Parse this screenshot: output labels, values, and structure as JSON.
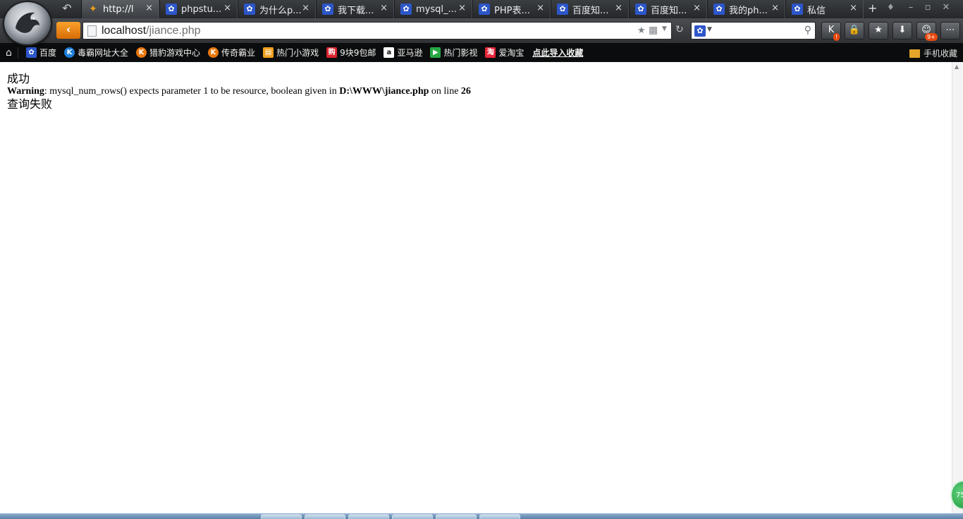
{
  "browser": {
    "tabs": [
      {
        "title": "http://l",
        "favicon": "kitty-favicon-icon",
        "active": true
      },
      {
        "title": "phpstu...",
        "favicon": "baidu-paw-icon"
      },
      {
        "title": "为什么p...",
        "favicon": "baidu-paw-icon"
      },
      {
        "title": "我下载...",
        "favicon": "baidu-paw-icon"
      },
      {
        "title": "mysql_...",
        "favicon": "baidu-paw-icon"
      },
      {
        "title": "PHP表...",
        "favicon": "baidu-paw-icon"
      },
      {
        "title": "百度知...",
        "favicon": "baidu-paw-icon"
      },
      {
        "title": "百度知...",
        "favicon": "baidu-paw-icon"
      },
      {
        "title": "我的ph...",
        "favicon": "baidu-paw-icon"
      },
      {
        "title": "私信",
        "favicon": "baidu-paw-icon"
      }
    ],
    "close_glyph": "×",
    "new_tab_glyph": "+",
    "address": {
      "host": "localhost",
      "path": "/jiance.php"
    },
    "search": {
      "value": ""
    },
    "toolbar_badges": {
      "k_button": "!",
      "game_button": "9+"
    },
    "bookmarks": [
      {
        "label": "百度",
        "icon": "baidu-paw-icon",
        "color": "#2d56c9"
      },
      {
        "label": "毒霸网址大全",
        "icon": "duba-k-icon",
        "color": "#1e7fd8"
      },
      {
        "label": "猎豹游戏中心",
        "icon": "cheetah-game-icon",
        "color": "#e8780e"
      },
      {
        "label": "传奇霸业",
        "icon": "legend-icon",
        "color": "#e8780e"
      },
      {
        "label": "热门小游戏",
        "icon": "minigame-icon",
        "color": "#f0a020"
      },
      {
        "label": "9块9包邮",
        "icon": "shopping-icon",
        "color": "#d9232e"
      },
      {
        "label": "亚马逊",
        "icon": "amazon-icon",
        "color": "#ffffff"
      },
      {
        "label": "热门影视",
        "icon": "video-play-icon",
        "color": "#27a844"
      },
      {
        "label": "爱淘宝",
        "icon": "taobao-icon",
        "color": "#e8263a"
      },
      {
        "label": "点此导入收藏",
        "icon": "",
        "color": ""
      }
    ],
    "mobile_favorites": "手机收藏",
    "speed_ball": "75"
  },
  "page": {
    "line1": "成功",
    "warning": {
      "label": "Warning",
      "message": ": mysql_num_rows() expects parameter 1 to be resource, boolean given in ",
      "file": "D:\\WWW\\jiance.php",
      "on_line": " on line ",
      "line_number": "26"
    },
    "line3": "查询失败"
  }
}
